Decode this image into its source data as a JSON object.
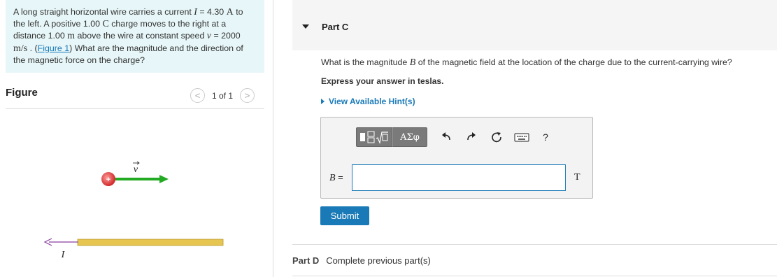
{
  "problem": {
    "t1": "A long straight horizontal wire carries a current ",
    "current_sym": "I",
    "t2": " = 4.30 ",
    "current_unit": "A",
    "t3": " to the left. A positive 1.00 ",
    "charge_unit": "C",
    "t4": " charge moves to the right at a distance 1.00 ",
    "dist_unit": "m",
    "t5": " above the wire at constant speed ",
    "speed_sym": "v",
    "t6": " = 2000 ",
    "speed_unit": "m/s",
    "t7": " . (",
    "figure_link": "Figure 1",
    "t8": ") What are the magnitude and the direction of the magnetic force on the charge?"
  },
  "figure": {
    "title": "Figure",
    "pager": "1 of 1",
    "prev_glyph": "<",
    "next_glyph": ">",
    "charge_sign": "+",
    "v_label": "v",
    "current_label": "I",
    "colors": {
      "arrow": "#22aa22",
      "charge": "#e03c3c",
      "wire": "#e6c651",
      "current_arrow": "#8a3fa0"
    }
  },
  "part_c": {
    "title": "Part C",
    "question_pre": "What is the magnitude ",
    "question_sym": "B",
    "question_post": " of the magnetic field at the location of the charge due to the current-carrying wire?",
    "instruction": "Express your answer in teslas.",
    "hint": "View Available Hint(s)",
    "toolbar": {
      "greek": "ΑΣφ",
      "help": "?"
    },
    "answer_label_sym": "B",
    "answer_label_eq": " =",
    "answer_value": "",
    "unit": "T",
    "submit": "Submit"
  },
  "part_d": {
    "title": "Part D",
    "status": "Complete previous part(s)"
  },
  "colors": {
    "accent": "#1a7ab8",
    "problem_bg": "#e7f6f8",
    "header_bg": "#f5f5f5"
  }
}
